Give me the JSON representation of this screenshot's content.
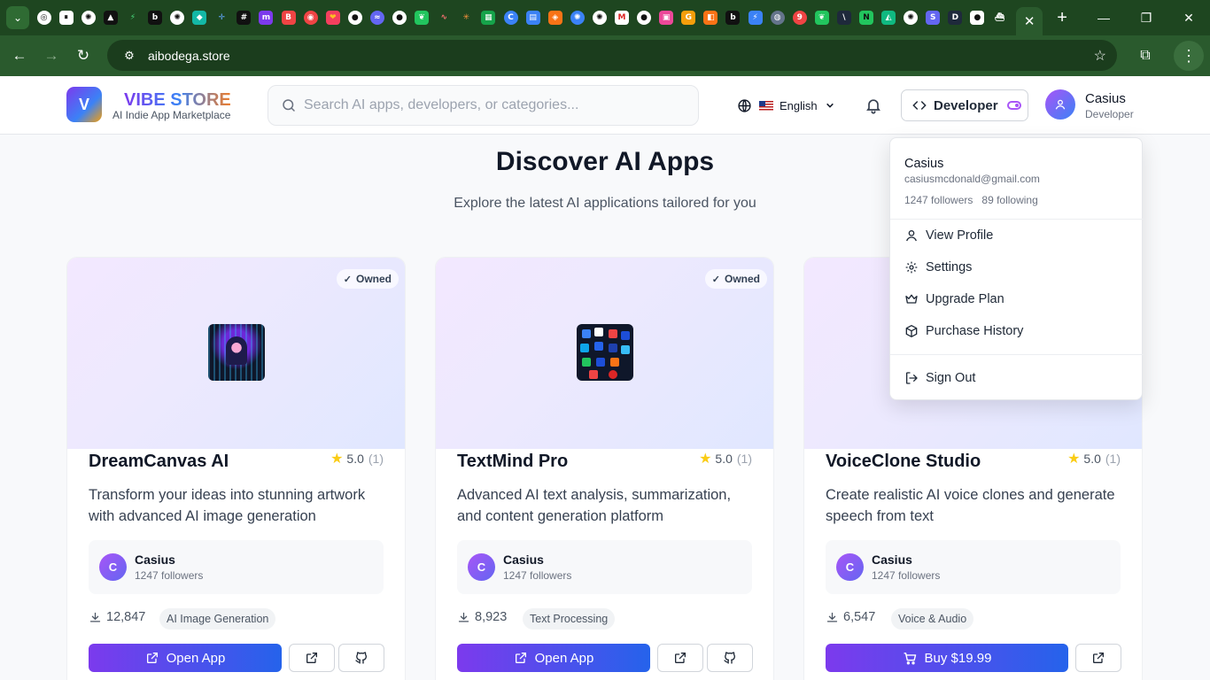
{
  "browser": {
    "url": "aibodega.store",
    "favicons": [
      {
        "name": "chatgpt-favicon",
        "bg": "#ffffff",
        "fg": "#111111",
        "glyph": "◎",
        "round": true
      },
      {
        "name": "pause-favicon",
        "bg": "#ffffff",
        "fg": "#111111",
        "glyph": "⏸"
      },
      {
        "name": "openai-favicon",
        "bg": "#ffffff",
        "fg": "#111111",
        "glyph": "✺",
        "round": true
      },
      {
        "name": "triangle-favicon",
        "bg": "#111111",
        "fg": "#ffffff",
        "glyph": "▲"
      },
      {
        "name": "bolt-favicon",
        "bg": "#1e4620",
        "fg": "#4ade80",
        "glyph": "⚡"
      },
      {
        "name": "b-favicon",
        "bg": "#111111",
        "fg": "#ffffff",
        "glyph": "b"
      },
      {
        "name": "openai-favicon",
        "bg": "#ffffff",
        "fg": "#111111",
        "glyph": "✺",
        "round": true
      },
      {
        "name": "diamond-favicon",
        "bg": "#14b8a6",
        "fg": "#ffffff",
        "glyph": "◆"
      },
      {
        "name": "crosshair-favicon",
        "bg": "#1e4620",
        "fg": "#60a5fa",
        "glyph": "✛"
      },
      {
        "name": "hash-favicon",
        "bg": "#111111",
        "fg": "#ffffff",
        "glyph": "#"
      },
      {
        "name": "m-favicon",
        "bg": "#7c3aed",
        "fg": "#ffffff",
        "glyph": "m"
      },
      {
        "name": "bc-favicon",
        "bg": "#ef4444",
        "fg": "#ffffff",
        "glyph": "B"
      },
      {
        "name": "target-favicon",
        "bg": "#ef4444",
        "fg": "#ffffff",
        "glyph": "◉",
        "round": true
      },
      {
        "name": "heart-favicon",
        "bg": "#f43f5e",
        "fg": "#fbbf24",
        "glyph": "❤"
      },
      {
        "name": "github-favicon",
        "bg": "#ffffff",
        "fg": "#111111",
        "glyph": "●",
        "round": true
      },
      {
        "name": "wave-favicon",
        "bg": "#6366f1",
        "fg": "#ffffff",
        "glyph": "≈",
        "round": true
      },
      {
        "name": "github-favicon",
        "bg": "#ffffff",
        "fg": "#111111",
        "glyph": "●",
        "round": true
      },
      {
        "name": "leaf-favicon",
        "bg": "#22c55e",
        "fg": "#ffffff",
        "glyph": "❦"
      },
      {
        "name": "squiggle-favicon",
        "bg": "#1e4620",
        "fg": "#f87171",
        "glyph": "∿"
      },
      {
        "name": "spark-favicon",
        "bg": "#1e4620",
        "fg": "#fb923c",
        "glyph": "✳"
      },
      {
        "name": "sheets-favicon",
        "bg": "#16a34a",
        "fg": "#ffffff",
        "glyph": "▦"
      },
      {
        "name": "c-favicon",
        "bg": "#3b82f6",
        "fg": "#ffffff",
        "glyph": "C",
        "round": true
      },
      {
        "name": "calendar-favicon",
        "bg": "#3b82f6",
        "fg": "#ffffff",
        "glyph": "▤"
      },
      {
        "name": "fox-favicon",
        "bg": "#f97316",
        "fg": "#ffffff",
        "glyph": "◈"
      },
      {
        "name": "chatgpt-favicon",
        "bg": "#3b82f6",
        "fg": "#ffffff",
        "glyph": "✺",
        "round": true
      },
      {
        "name": "openai-favicon",
        "bg": "#ffffff",
        "fg": "#111111",
        "glyph": "✺",
        "round": true
      },
      {
        "name": "gmail-favicon",
        "bg": "#ffffff",
        "fg": "#dc2626",
        "glyph": "M"
      },
      {
        "name": "github-favicon",
        "bg": "#ffffff",
        "fg": "#111111",
        "glyph": "●",
        "round": true
      },
      {
        "name": "pink-favicon",
        "bg": "#ec4899",
        "fg": "#ffffff",
        "glyph": "▣"
      },
      {
        "name": "g-favicon",
        "bg": "#f59e0b",
        "fg": "#ffffff",
        "glyph": "G"
      },
      {
        "name": "box-favicon",
        "bg": "#f97316",
        "fg": "#ffffff",
        "glyph": "◧"
      },
      {
        "name": "b-favicon",
        "bg": "#111111",
        "fg": "#ffffff",
        "glyph": "b"
      },
      {
        "name": "bolt-favicon",
        "bg": "#3b82f6",
        "fg": "#ffffff",
        "glyph": "⚡"
      },
      {
        "name": "globe-favicon",
        "bg": "#64748b",
        "fg": "#ffffff",
        "glyph": "◍",
        "round": true
      },
      {
        "name": "nine-favicon",
        "bg": "#ef4444",
        "fg": "#ffffff",
        "glyph": "9",
        "round": true
      },
      {
        "name": "leaf-favicon",
        "bg": "#22c55e",
        "fg": "#ffffff",
        "glyph": "❦"
      },
      {
        "name": "backslash-favicon",
        "bg": "#1e293b",
        "fg": "#ffffff",
        "glyph": "\\"
      },
      {
        "name": "n-favicon",
        "bg": "#22c55e",
        "fg": "#111111",
        "glyph": "N"
      },
      {
        "name": "shape-favicon",
        "bg": "#10b981",
        "fg": "#ffffff",
        "glyph": "◭"
      },
      {
        "name": "openai-favicon",
        "bg": "#ffffff",
        "fg": "#111111",
        "glyph": "✺",
        "round": true
      },
      {
        "name": "s-favicon",
        "bg": "#6366f1",
        "fg": "#ffffff",
        "glyph": "S"
      },
      {
        "name": "d-favicon",
        "bg": "#1e293b",
        "fg": "#ffffff",
        "glyph": "D"
      },
      {
        "name": "dot-favicon",
        "bg": "#ffffff",
        "fg": "#111111",
        "glyph": "●"
      },
      {
        "name": "ship-favicon",
        "bg": "#1e4620",
        "fg": "#ffffff",
        "glyph": "⛴"
      }
    ]
  },
  "header": {
    "logo_letter": "V",
    "brand": "VIBE STORE",
    "tagline": "AI Indie App Marketplace",
    "search_placeholder": "Search AI apps, developers, or categories...",
    "language": "English",
    "developer_label": "Developer",
    "user_name": "Casius",
    "user_role": "Developer"
  },
  "main": {
    "title": "Discover AI Apps",
    "subtitle": "Explore the latest AI applications tailored for you"
  },
  "cards": [
    {
      "owned_label": "Owned",
      "title": "DreamCanvas AI",
      "rating": "5.0",
      "rating_count": "(1)",
      "description": "Transform your ideas into stunning artwork with advanced AI image generation",
      "developer_initial": "C",
      "developer": "Casius",
      "followers": "1247 followers",
      "downloads": "12,847",
      "category": "AI Image Generation",
      "primary_label": "Open App"
    },
    {
      "owned_label": "Owned",
      "title": "TextMind Pro",
      "rating": "5.0",
      "rating_count": "(1)",
      "description": "Advanced AI text analysis, summarization, and content generation platform",
      "developer_initial": "C",
      "developer": "Casius",
      "followers": "1247 followers",
      "downloads": "8,923",
      "category": "Text Processing",
      "primary_label": "Open App"
    },
    {
      "title": "VoiceClone Studio",
      "rating": "5.0",
      "rating_count": "(1)",
      "description": "Create realistic AI voice clones and generate speech from text",
      "developer_initial": "C",
      "developer": "Casius",
      "followers": "1247 followers",
      "downloads": "6,547",
      "category": "Voice & Audio",
      "primary_label": "Buy $19.99"
    }
  ],
  "dropdown": {
    "name": "Casius",
    "email": "casiusmcdonald@gmail.com",
    "followers": "1247 followers",
    "following": "89 following",
    "items": [
      "View Profile",
      "Settings",
      "Upgrade Plan",
      "Purchase History"
    ],
    "sign_out": "Sign Out"
  },
  "colors": {
    "browser_frame": "#1e4620",
    "accent_purple": "#7c3aed",
    "accent_blue": "#2563eb",
    "star": "#facc15"
  }
}
